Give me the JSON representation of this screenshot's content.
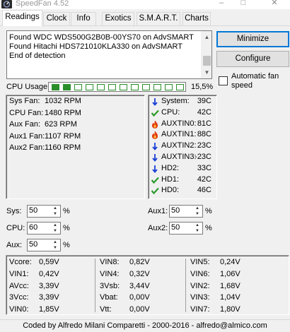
{
  "window": {
    "title": "SpeedFan 4.52",
    "controls": {
      "minimize": "–",
      "maximize": "□",
      "close": "✕"
    }
  },
  "tabs": [
    {
      "label": "Readings",
      "active": true
    },
    {
      "label": "Clock"
    },
    {
      "label": "Info"
    },
    {
      "label": "Exotics"
    },
    {
      "label": "S.M.A.R.T."
    },
    {
      "label": "Charts"
    }
  ],
  "log": {
    "lines": [
      "Found WDC  WDS500G2B0B-00YS70 on AdvSMART",
      "Found Hitachi HDS721010KLA330 on AdvSMART",
      "End of detection"
    ]
  },
  "buttons": {
    "minimize": "Minimize",
    "configure": "Configure"
  },
  "auto_fan_speed": {
    "label": "Automatic fan speed",
    "checked": false
  },
  "cpu_usage": {
    "label": "CPU Usage",
    "percent": "15,5%",
    "fraction": 0.155,
    "segments": 12
  },
  "fans": [
    {
      "label": "Sys Fan:",
      "value": "1032 RPM"
    },
    {
      "label": "CPU Fan:",
      "value": "1480 RPM"
    },
    {
      "label": "Aux Fan:",
      "value": "623 RPM"
    },
    {
      "label": "Aux1 Fan:",
      "value": "1107 RPM"
    },
    {
      "label": "Aux2 Fan:",
      "value": "1160 RPM"
    }
  ],
  "temps": [
    {
      "icon": "arrow-down-icon",
      "label": "System:",
      "value": "39C"
    },
    {
      "icon": "checkmark-icon",
      "label": "CPU:",
      "value": "42C"
    },
    {
      "icon": "flame-icon",
      "label": "AUXTIN0:",
      "value": "81C"
    },
    {
      "icon": "flame-icon",
      "label": "AUXTIN1:",
      "value": "88C"
    },
    {
      "icon": "arrow-down-icon",
      "label": "AUXTIN2:",
      "value": "23C"
    },
    {
      "icon": "arrow-down-icon",
      "label": "AUXTIN3:",
      "value": "-23C"
    },
    {
      "icon": "arrow-down-icon",
      "label": "HD2:",
      "value": "33C"
    },
    {
      "icon": "checkmark-icon",
      "label": "HD1:",
      "value": "42C"
    },
    {
      "icon": "checkmark-icon",
      "label": "HD0:",
      "value": "46C"
    }
  ],
  "speeds": {
    "left": [
      {
        "label": "Sys:",
        "value": "50",
        "unit": "%"
      },
      {
        "label": "CPU:",
        "value": "60",
        "unit": "%"
      },
      {
        "label": "Aux:",
        "value": "50",
        "unit": "%"
      }
    ],
    "right": [
      {
        "label": "Aux1:",
        "value": "50",
        "unit": "%"
      },
      {
        "label": "Aux2:",
        "value": "50",
        "unit": "%"
      }
    ]
  },
  "voltages": {
    "col1": [
      {
        "label": "Vcore:",
        "value": "0,59V"
      },
      {
        "label": "VIN1:",
        "value": "0,42V"
      },
      {
        "label": "AVcc:",
        "value": "3,39V"
      },
      {
        "label": "3Vcc:",
        "value": "3,39V"
      },
      {
        "label": "VIN0:",
        "value": "1,85V"
      }
    ],
    "col2": [
      {
        "label": "VIN8:",
        "value": "0,82V"
      },
      {
        "label": "VIN4:",
        "value": "0,32V"
      },
      {
        "label": "3Vsb:",
        "value": "3,44V"
      },
      {
        "label": "Vbat:",
        "value": "0,00V"
      },
      {
        "label": "Vtt:",
        "value": "0,00V"
      }
    ],
    "col3": [
      {
        "label": "VIN5:",
        "value": "0,24V"
      },
      {
        "label": "VIN6:",
        "value": "1,06V"
      },
      {
        "label": "VIN2:",
        "value": "1,68V"
      },
      {
        "label": "VIN3:",
        "value": "1,04V"
      },
      {
        "label": "VIN7:",
        "value": "1,80V"
      }
    ]
  },
  "status": "Coded by Alfredo Milani Comparetti - 2000-2016 - alfredo@almico.com",
  "colors": {
    "segment_green": "#2a8f2a",
    "arrow_blue": "#1a3fd6",
    "check_green": "#2a9a2a",
    "flame_red": "#e23a10"
  }
}
